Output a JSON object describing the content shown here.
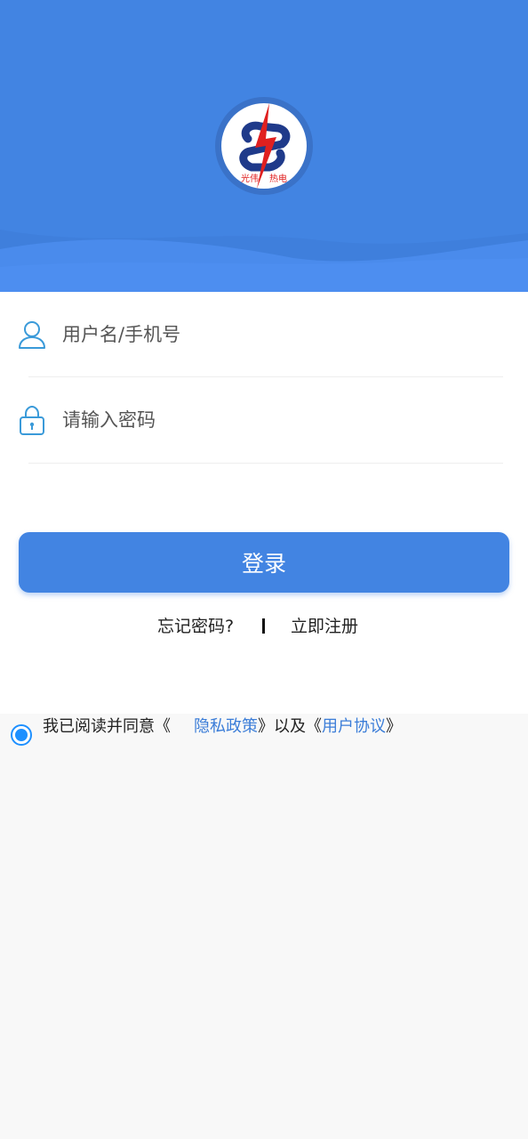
{
  "colors": {
    "brand_blue": "#4284e2",
    "link_blue": "#3b7dd8",
    "radio_blue": "#1e90ff",
    "logo_red": "#e02020",
    "logo_navy": "#1f3a8a"
  },
  "header": {
    "logo_text_left": "光伟",
    "logo_text_right": "热电"
  },
  "login_form": {
    "username": {
      "placeholder": "用户名/手机号",
      "value": "",
      "icon": "user-icon"
    },
    "password": {
      "placeholder": "请输入密码",
      "value": "",
      "icon": "lock-icon"
    },
    "login_label": "登录",
    "forgot_label": "忘记密码?",
    "register_label": "立即注册"
  },
  "agreement": {
    "checked": true,
    "prefix": "我已阅读并同意《",
    "privacy_label": "隐私政策",
    "middle": "》以及《",
    "terms_label": "用户协议",
    "suffix": "》"
  }
}
